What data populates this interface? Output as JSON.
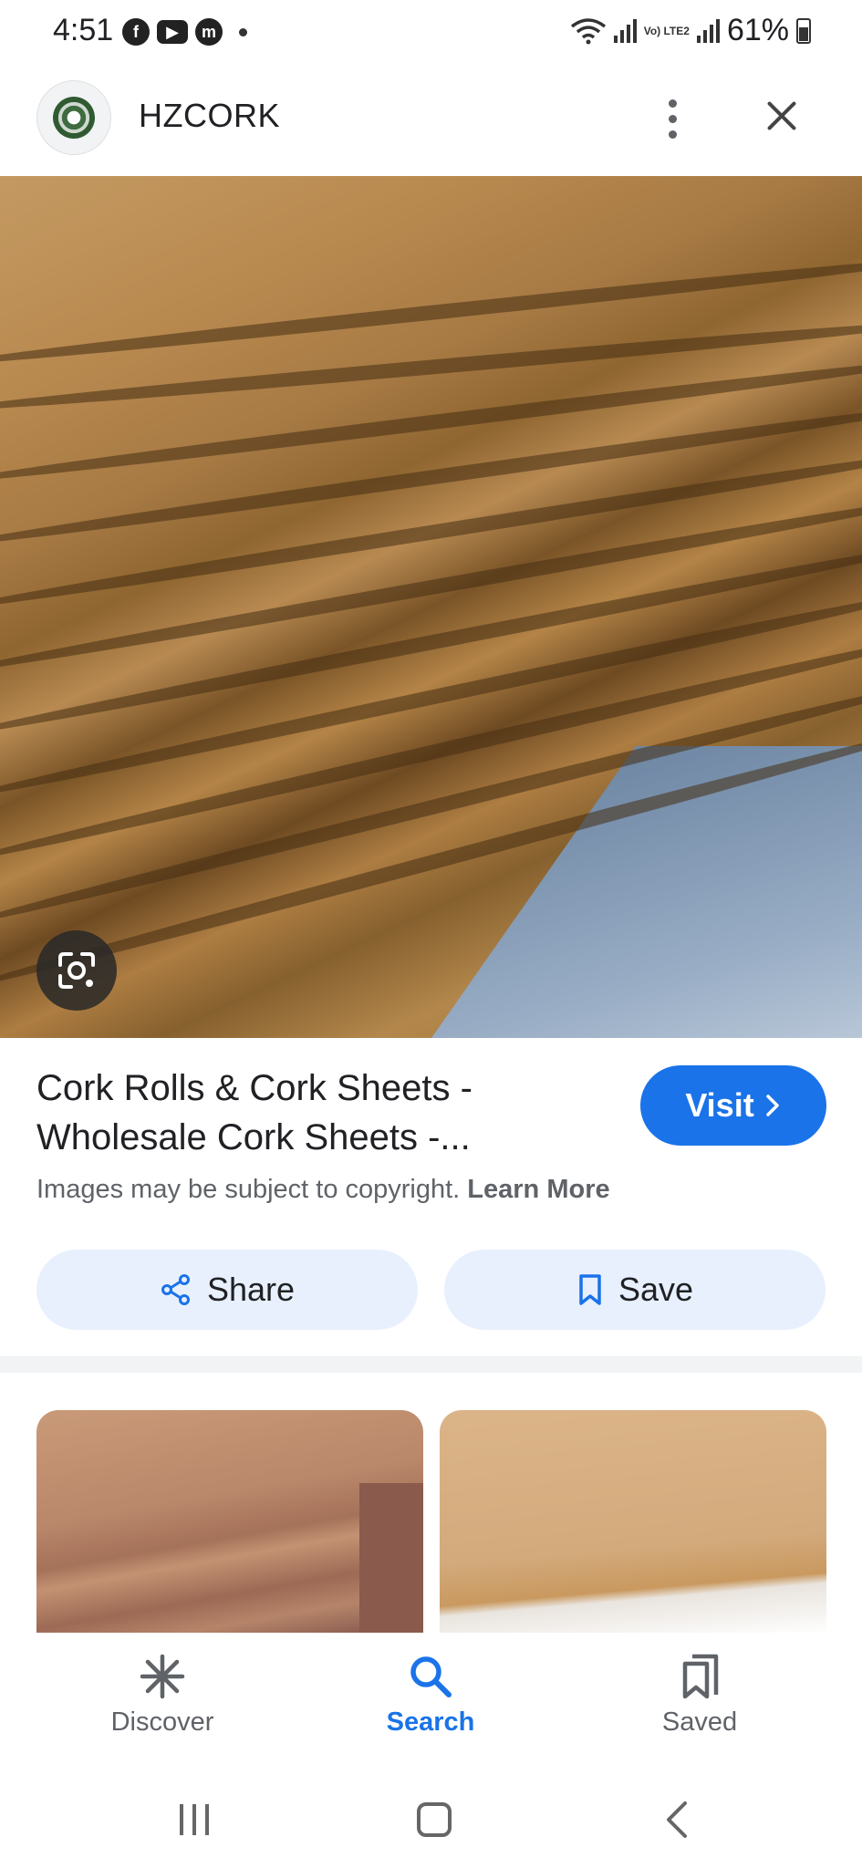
{
  "status_bar": {
    "time": "4:51",
    "apps": [
      "f",
      "▶",
      "m"
    ],
    "network": "Vo) LTE2",
    "battery": "61%"
  },
  "header": {
    "site_name": "HZCORK",
    "more_icon": "more-vert-icon",
    "close_icon": "close-icon"
  },
  "result": {
    "title": "Cork Rolls & Cork Sheets - Wholesale Cork Sheets -...",
    "visit_label": "Visit",
    "copyright_text": "Images may be subject to copyright.",
    "learn_more": "Learn More",
    "share_label": "Share",
    "save_label": "Save"
  },
  "bottom_nav": {
    "items": [
      {
        "label": "Discover",
        "icon": "asterisk-icon",
        "active": false
      },
      {
        "label": "Search",
        "icon": "search-icon",
        "active": true
      },
      {
        "label": "Saved",
        "icon": "bookmarks-icon",
        "active": false
      }
    ]
  },
  "colors": {
    "accent": "#1a73e8",
    "pill_bg": "#e8f0fe",
    "muted_text": "#5f6368"
  }
}
